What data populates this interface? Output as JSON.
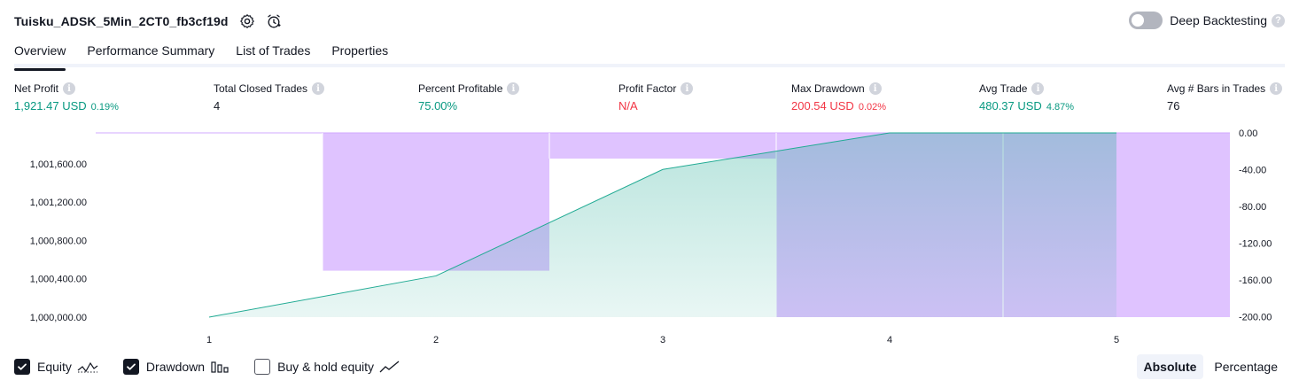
{
  "header": {
    "strategy_title": "Tuisku_ADSK_5Min_2CT0_fb3cf19d",
    "settings_icon": "gear-icon",
    "alert_icon": "add-alert-icon",
    "deep_backtesting_label": "Deep Backtesting",
    "deep_backtesting_enabled": false
  },
  "tabs": [
    {
      "label": "Overview",
      "active": true
    },
    {
      "label": "Performance Summary",
      "active": false
    },
    {
      "label": "List of Trades",
      "active": false
    },
    {
      "label": "Properties",
      "active": false
    }
  ],
  "metrics": [
    {
      "label": "Net Profit",
      "value": "1,921.47 USD",
      "percent": "0.19%",
      "tone": "pos"
    },
    {
      "label": "Total Closed Trades",
      "value": "4",
      "percent": "",
      "tone": "neutral"
    },
    {
      "label": "Percent Profitable",
      "value": "75.00%",
      "percent": "",
      "tone": "pos"
    },
    {
      "label": "Profit Factor",
      "value": "N/A",
      "percent": "",
      "tone": "neg"
    },
    {
      "label": "Max Drawdown",
      "value": "200.54 USD",
      "percent": "0.02%",
      "tone": "neg"
    },
    {
      "label": "Avg Trade",
      "value": "480.37 USD",
      "percent": "4.87%",
      "tone": "pos"
    },
    {
      "label": "Avg # Bars in Trades",
      "value": "76",
      "percent": "",
      "tone": "neutral"
    }
  ],
  "chart_data": {
    "type": "area",
    "x": [
      1,
      2,
      3,
      4,
      5
    ],
    "left_axis": {
      "ticks": [
        "1,000,000.00",
        "1,000,400.00",
        "1,000,800.00",
        "1,001,200.00",
        "1,001,600.00"
      ],
      "tick_values": [
        1000000,
        1000400,
        1000800,
        1001200,
        1001600
      ],
      "range": [
        1000000,
        1001921.47
      ]
    },
    "right_axis": {
      "ticks": [
        "0.00",
        "-40.00",
        "-80.00",
        "-120.00",
        "-160.00",
        "-200.00"
      ],
      "tick_values": [
        0,
        -40,
        -80,
        -120,
        -160,
        -200
      ],
      "range": [
        -200.54,
        0
      ]
    },
    "x_ticks": [
      "1",
      "2",
      "3",
      "4",
      "5"
    ],
    "series": [
      {
        "name": "Equity",
        "type": "area",
        "color": "#22ab94",
        "x": [
          1,
          2,
          3,
          4,
          5
        ],
        "values": [
          1000000,
          1000430,
          1001540,
          1001921.47,
          1001921.47
        ]
      },
      {
        "name": "Drawdown",
        "type": "bar",
        "color": "#d1a9ff",
        "x": [
          1,
          2,
          3,
          4,
          5
        ],
        "values": [
          0,
          -150,
          -28,
          -200.54,
          -200.54
        ]
      }
    ],
    "grid": false
  },
  "legend": {
    "items": [
      {
        "label": "Equity",
        "checked": true,
        "icon": "equity-line-icon"
      },
      {
        "label": "Drawdown",
        "checked": true,
        "icon": "drawdown-bars-icon"
      },
      {
        "label": "Buy & hold equity",
        "checked": false,
        "icon": "buy-hold-line-icon"
      }
    ]
  },
  "view_modes": [
    {
      "label": "Absolute",
      "active": true
    },
    {
      "label": "Percentage",
      "active": false
    }
  ]
}
